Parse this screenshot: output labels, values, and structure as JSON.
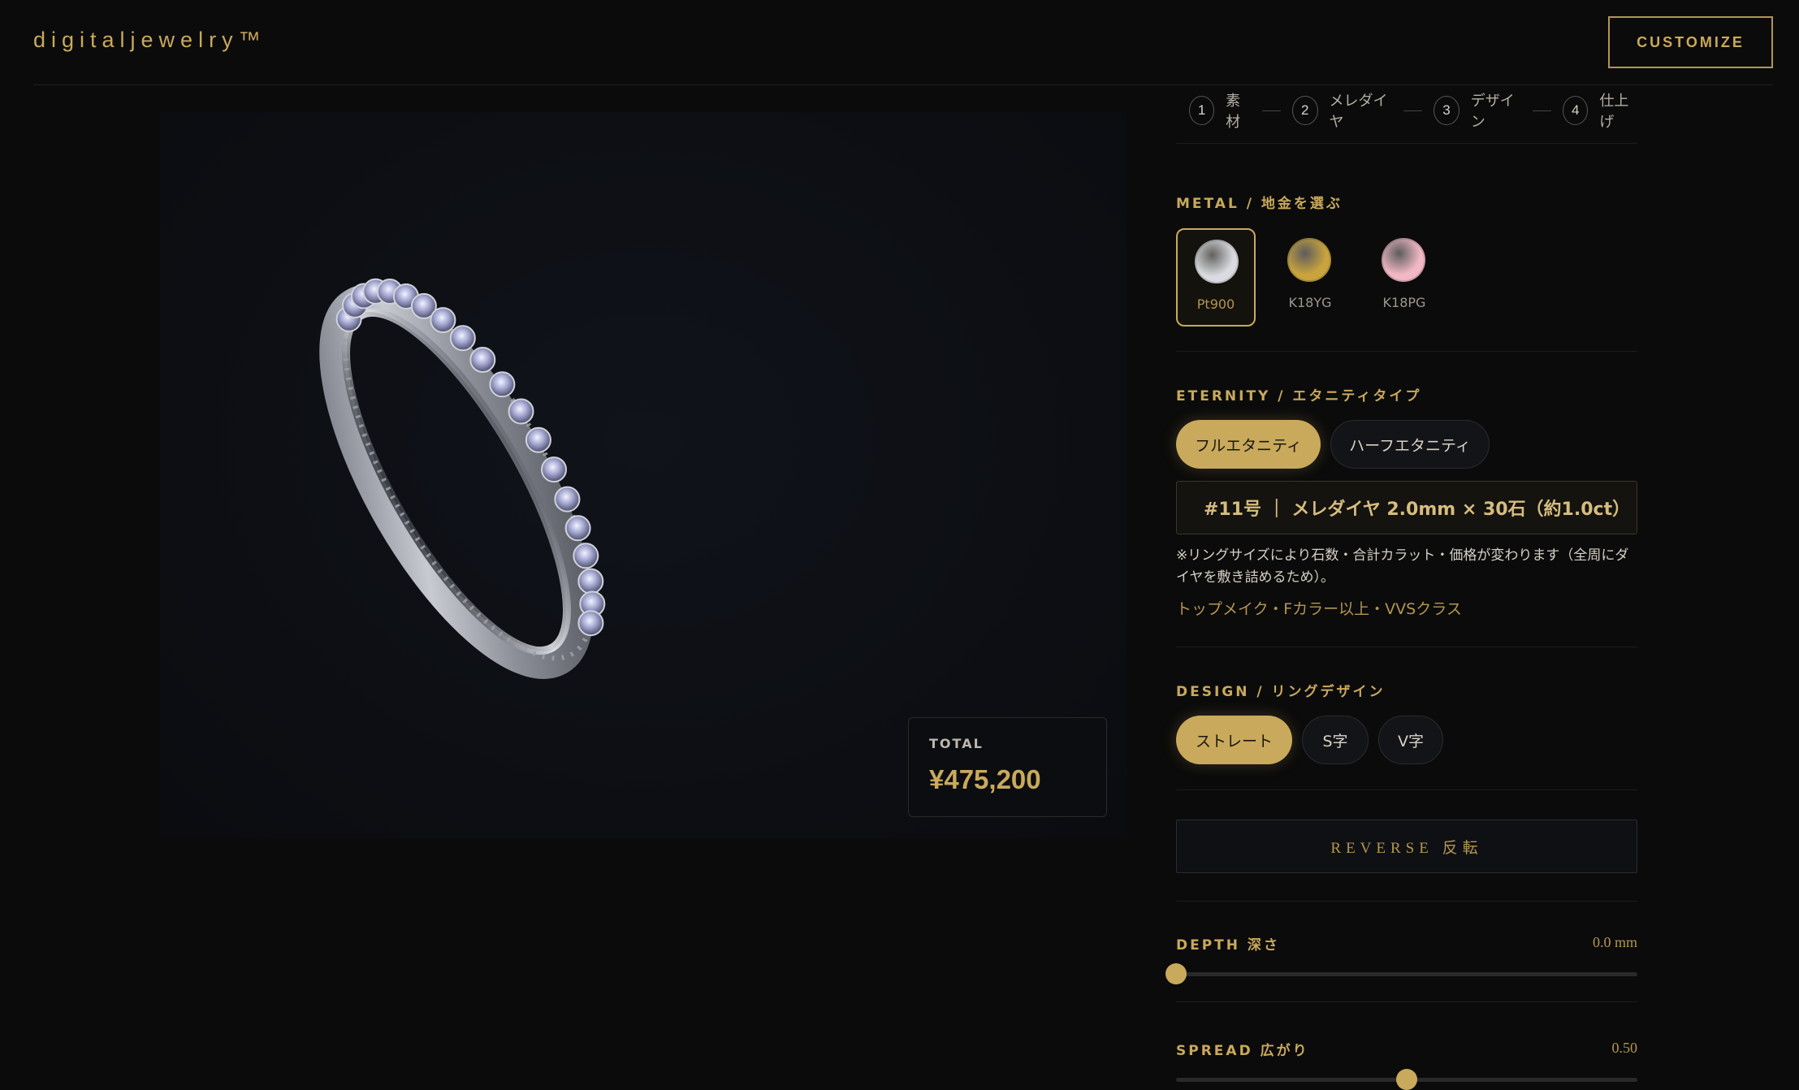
{
  "header": {
    "logo": "digitaljewelry™",
    "customize_label": "CUSTOMIZE"
  },
  "steps": [
    {
      "num": "1",
      "label": "素材"
    },
    {
      "num": "2",
      "label": "メレダイヤ"
    },
    {
      "num": "3",
      "label": "デザイン"
    },
    {
      "num": "4",
      "label": "仕上げ"
    }
  ],
  "total": {
    "label": "TOTAL",
    "value": "¥475,200"
  },
  "metal": {
    "title": "METAL / 地金を選ぶ",
    "options": [
      {
        "label": "Pt900",
        "color": "#d9dbe0",
        "selected": true
      },
      {
        "label": "K18YG",
        "color": "#c9a43e",
        "selected": false
      },
      {
        "label": "K18PG",
        "color": "#f0b7c4",
        "selected": false
      }
    ]
  },
  "eternity": {
    "title": "ETERNITY / エタニティタイプ",
    "options": [
      {
        "label": "フルエタニティ",
        "selected": true
      },
      {
        "label": "ハーフエタニティ",
        "selected": false
      }
    ],
    "spec": "#11号 ｜ メレダイヤ 2.0mm × 30石（約1.0ct）",
    "note": "※リングサイズにより石数・合計カラット・価格が変わります（全周にダイヤを敷き詰めるため）。",
    "quality": "トップメイク・Fカラー以上・VVSクラス"
  },
  "design": {
    "title": "DESIGN / リングデザイン",
    "options": [
      {
        "label": "ストレート",
        "selected": true
      },
      {
        "label": "S字",
        "selected": false
      },
      {
        "label": "V字",
        "selected": false
      }
    ]
  },
  "reverse_label": "REVERSE 反転",
  "depth": {
    "title": "DEPTH 深さ",
    "value_text": "0.0 mm",
    "fraction": 0.0
  },
  "spread": {
    "title": "SPREAD 広がり",
    "value_text": "0.50",
    "fraction": 0.5
  },
  "colors": {
    "accent": "#c9a95b",
    "background": "#0b0b0b"
  }
}
